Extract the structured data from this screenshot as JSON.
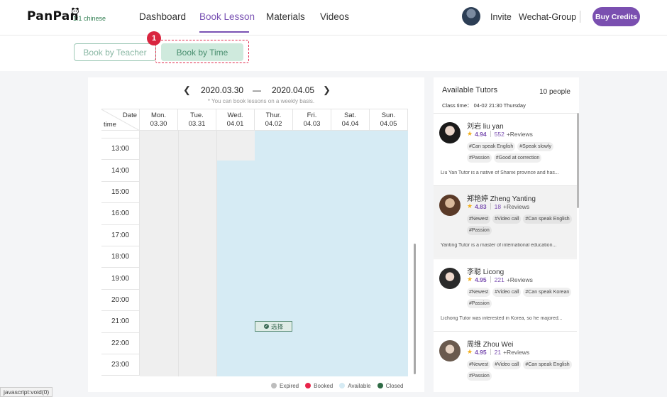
{
  "header": {
    "logo": "PanPan",
    "logo_sub": "1:1 chinese",
    "nav": [
      {
        "label": "Dashboard",
        "active": false
      },
      {
        "label": "Book Lesson",
        "active": true
      },
      {
        "label": "Materials",
        "active": false
      },
      {
        "label": "Videos",
        "active": false
      }
    ],
    "invite": "Invite",
    "wechat": "Wechat-Group",
    "buy_credits": "Buy Credits"
  },
  "tabs": {
    "by_teacher": "Book by Teacher",
    "by_time": "Book by Time",
    "step_badge": "1"
  },
  "calendar": {
    "week_start": "2020.03.30",
    "week_dash": "—",
    "week_end": "2020.04.05",
    "note": "* You can book lessons on a weekly basis.",
    "corner_date": "Date",
    "corner_time": "time",
    "days": [
      {
        "name": "Mon.",
        "date": "03.30"
      },
      {
        "name": "Tue.",
        "date": "03.31"
      },
      {
        "name": "Wed.",
        "date": "04.01"
      },
      {
        "name": "Thur.",
        "date": "04.02"
      },
      {
        "name": "Fri.",
        "date": "04.03"
      },
      {
        "name": "Sat.",
        "date": "04.04"
      },
      {
        "name": "Sun.",
        "date": "04.05"
      }
    ],
    "times": [
      "13:00",
      "14:00",
      "15:00",
      "16:00",
      "17:00",
      "18:00",
      "19:00",
      "20:00",
      "21:00",
      "22:00",
      "23:00"
    ],
    "selected_label": "选择",
    "legend": [
      {
        "label": "Expired",
        "color": "#bdbdbd"
      },
      {
        "label": "Booked",
        "color": "#e8244a"
      },
      {
        "label": "Available",
        "color": "#d6ebf4"
      },
      {
        "label": "Closed",
        "color": "#2e6b45"
      }
    ]
  },
  "tutors_panel": {
    "title": "Available Tutors",
    "count": "10 people",
    "class_time": "Class time： 04-02 21:30 Thursday",
    "tutors": [
      {
        "name": "刘岩 liu yan",
        "rating": "4.94",
        "reviews": "552",
        "reviews_label": "+Reviews",
        "tags": [
          "#Can speak English",
          "#Speak slowly",
          "#Passion",
          "#Good at correction"
        ],
        "desc": "Liu Yan Tutor is a native of Shanxi province and has..."
      },
      {
        "name": "郑艳婷 Zheng Yanting",
        "rating": "4.83",
        "reviews": "18",
        "reviews_label": "+Reviews",
        "tags": [
          "#Newest",
          "#Video call",
          "#Can speak English",
          "#Passion"
        ],
        "desc": "Yanting Tutor is a master of international education..."
      },
      {
        "name": "李聪 Licong",
        "rating": "4.95",
        "reviews": "221",
        "reviews_label": "+Reviews",
        "tags": [
          "#Newest",
          "#Video call",
          "#Can speak Korean",
          "#Passion"
        ],
        "desc": "Lichong Tutor was interested in Korea, so he majored..."
      },
      {
        "name": "周维 Zhou Wei",
        "rating": "4.95",
        "reviews": "21",
        "reviews_label": "+Reviews",
        "tags": [
          "#Newest",
          "#Video call",
          "#Can speak English",
          "#Passion"
        ],
        "desc": ""
      }
    ]
  },
  "status_bar": "javascript:void(0)"
}
